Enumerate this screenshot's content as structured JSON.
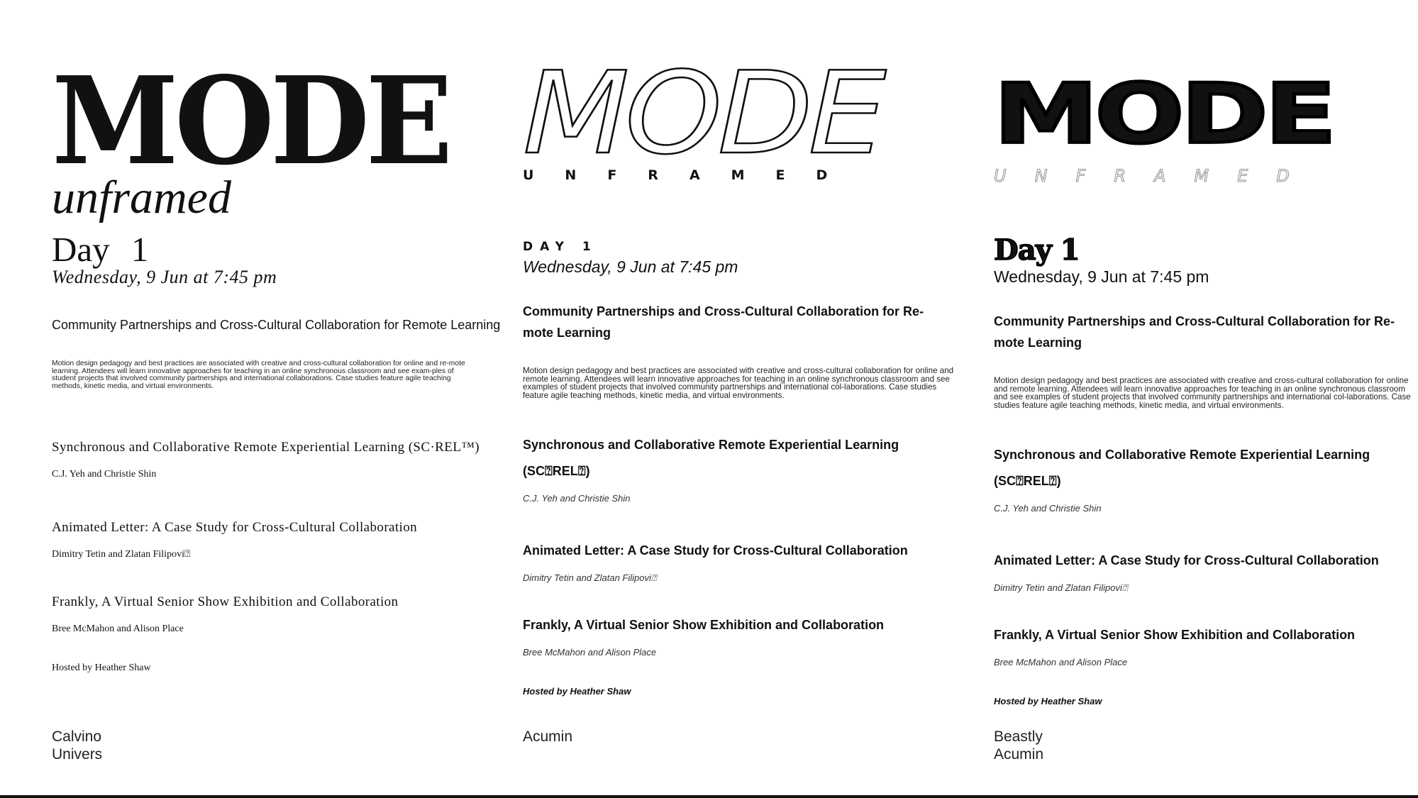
{
  "columns": [
    {
      "logo": "MODE",
      "subtitle": "unframed",
      "day": "Day 1",
      "date": "Wednesday, 9 Jun at 7:45 pm",
      "talk1_title": "Community Partnerships and Cross-Cultural Collaboration for Remote Learning",
      "talk1_description": "Motion design pedagogy and best practices are associated with creative and cross-cultural collaboration for online and re-mote learning. Attendees will learn innovative approaches for teaching in an online synchronous classroom and see exam-ples of student projects that involved community partnerships and international collaborations. Case studies feature agile teaching methods, kinetic media, and virtual environments.",
      "talk2_title": "Synchronous and Collaborative Remote Experiential Learning (SC·REL™)",
      "talk2_authors": "C.J. Yeh and Christie Shin",
      "talk3_title": "Animated Letter: A Case Study for Cross-Cultural Collaboration",
      "talk3_authors": "Dimitry Tetin and Zlatan Filipovi⍰",
      "talk4_title": "Frankly, A Virtual Senior Show Exhibition and Collaboration",
      "talk4_authors": "Bree McMahon and Alison Place",
      "host": "Hosted by Heather Shaw",
      "fonts": [
        "Calvino",
        "Univers"
      ]
    },
    {
      "logo": "MODE",
      "subtitle": "UNFRAMED",
      "day": "DAY 1",
      "date": "Wednesday, 9 Jun at 7:45 pm",
      "talk1_title": "Community Partnerships and Cross-Cultural Collaboration for Re-mote Learning",
      "talk1_description": "Motion design pedagogy and best practices are associated with creative and cross-cultural collaboration for online and remote learning. Attendees will learn innovative approaches for teaching in an online synchronous classroom and see examples of student projects that involved community partnerships and international col-laborations. Case studies feature agile teaching methods, kinetic media, and virtual environments.",
      "talk2_title": "Synchronous and Collaborative Remote Experiential Learning (SC⍰REL⍰)",
      "talk2_authors": "C.J. Yeh and Christie Shin",
      "talk3_title": "Animated Letter: A Case Study for Cross-Cultural Collaboration",
      "talk3_authors": "Dimitry Tetin and Zlatan Filipovi⍰",
      "talk4_title": "Frankly, A Virtual Senior Show Exhibition and Collaboration",
      "talk4_authors": "Bree McMahon and Alison Place",
      "host": "Hosted by Heather Shaw",
      "fonts": [
        "Acumin"
      ]
    },
    {
      "logo": "MODE",
      "subtitle": "UNFRAMED",
      "day": "Day 1",
      "date": "Wednesday, 9 Jun at 7:45 pm",
      "talk1_title": "Community Partnerships and Cross-Cultural Collaboration for Re-mote Learning",
      "talk1_description": "Motion design pedagogy and best practices are associated with creative and cross-cultural collaboration for online and remote learning. Attendees will learn innovative approaches for teaching in an online synchronous classroom and see examples of student projects that involved community partnerships and international col-laborations. Case studies feature agile teaching methods, kinetic media, and virtual environments.",
      "talk2_title": "Synchronous and Collaborative Remote Experiential Learning (SC⍰REL⍰)",
      "talk2_authors": "C.J. Yeh and Christie Shin",
      "talk3_title": "Animated Letter: A Case Study for Cross-Cultural Collaboration",
      "talk3_authors": "Dimitry Tetin and Zlatan Filipovi⍰",
      "talk4_title": "Frankly, A Virtual Senior Show Exhibition and Collaboration",
      "talk4_authors": "Bree McMahon and Alison Place",
      "host": "Hosted by Heather Shaw",
      "fonts": [
        "Beastly",
        "Acumin"
      ]
    }
  ]
}
